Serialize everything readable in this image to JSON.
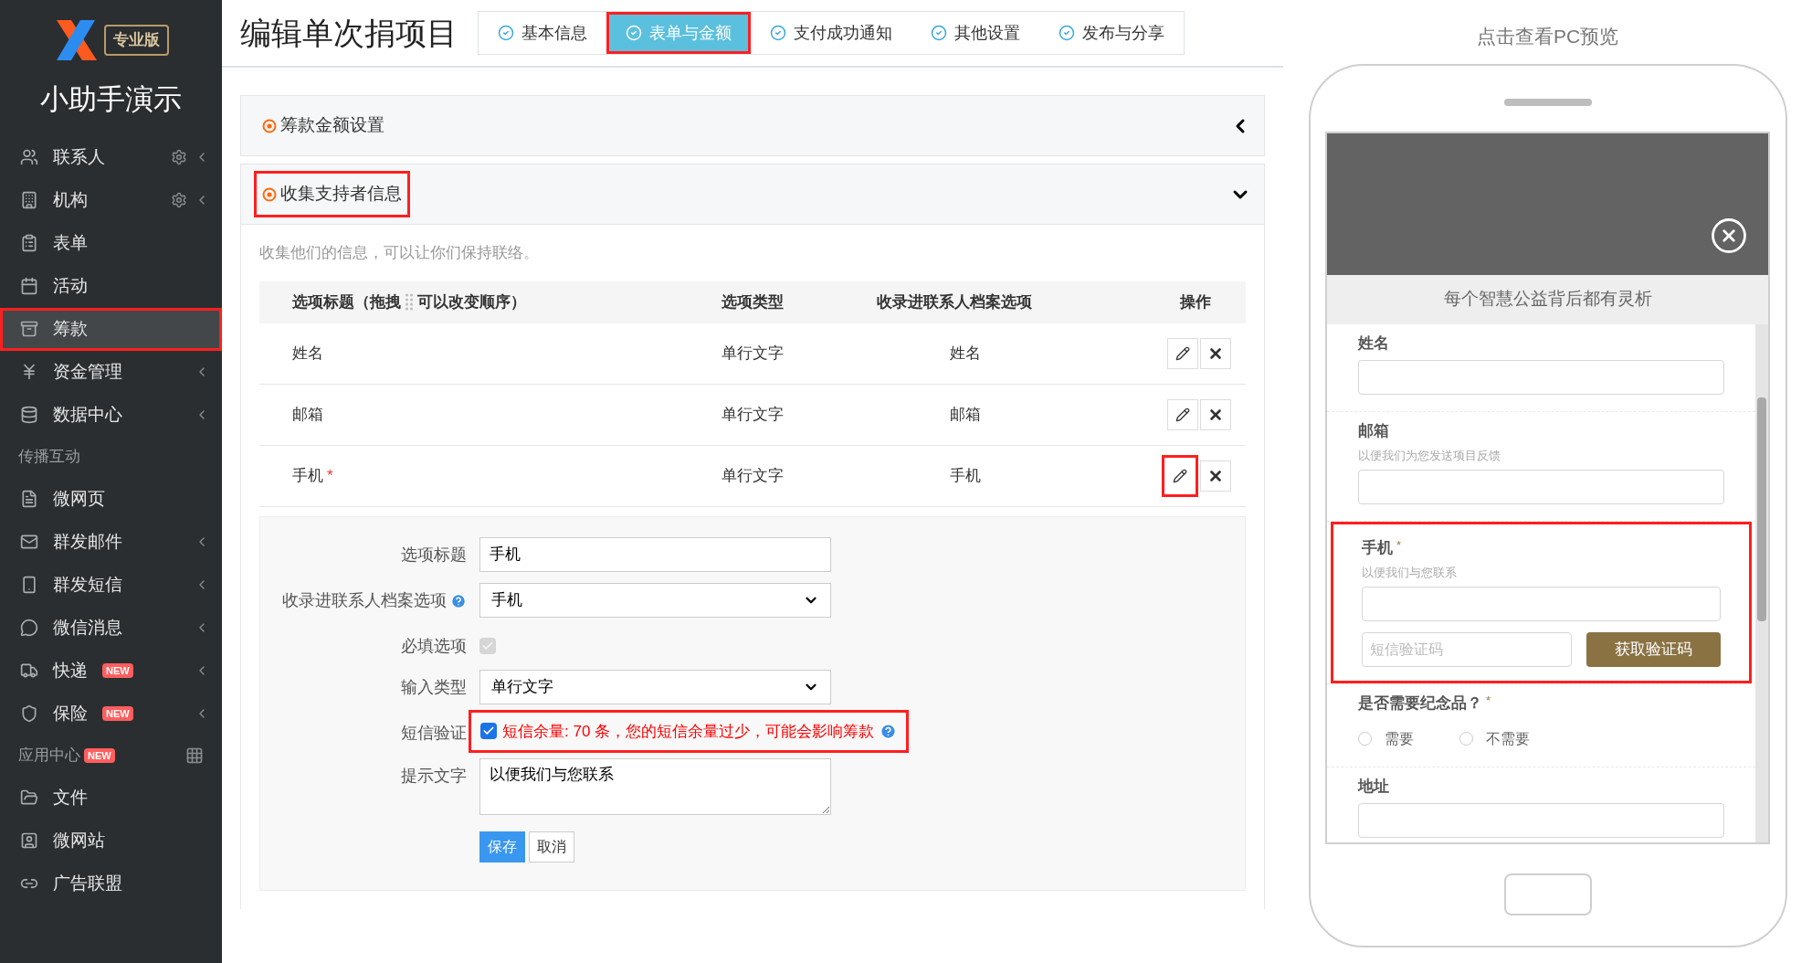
{
  "sidebar": {
    "logo_badge": "专业版",
    "org_name": "小助手演示",
    "items": [
      {
        "kind": "item",
        "label": "联系人",
        "selected": false,
        "settings": true,
        "expandable": true,
        "highlighted": false
      },
      {
        "kind": "item",
        "label": "机构",
        "selected": false,
        "settings": true,
        "expandable": true
      },
      {
        "kind": "item",
        "label": "表单",
        "selected": false,
        "settings": false,
        "expandable": false
      },
      {
        "kind": "item",
        "label": "活动",
        "selected": false,
        "settings": false,
        "expandable": false
      },
      {
        "kind": "item",
        "label": "筹款",
        "selected": true,
        "settings": false,
        "expandable": false,
        "highlighted": true
      },
      {
        "kind": "item",
        "label": "资金管理",
        "selected": false,
        "settings": false,
        "expandable": true
      },
      {
        "kind": "item",
        "label": "数据中心",
        "selected": false,
        "settings": false,
        "expandable": true
      },
      {
        "kind": "section",
        "label": "传播互动"
      },
      {
        "kind": "item",
        "label": "微网页",
        "selected": false,
        "settings": false,
        "expandable": false
      },
      {
        "kind": "item",
        "label": "群发邮件",
        "selected": false,
        "settings": false,
        "expandable": true
      },
      {
        "kind": "item",
        "label": "群发短信",
        "selected": false,
        "settings": false,
        "expandable": true
      },
      {
        "kind": "item",
        "label": "微信消息",
        "selected": false,
        "settings": false,
        "expandable": true
      },
      {
        "kind": "item",
        "label": "快递",
        "selected": false,
        "settings": false,
        "expandable": true,
        "badge": "NEW"
      },
      {
        "kind": "item",
        "label": "保险",
        "selected": false,
        "settings": false,
        "expandable": true,
        "badge": "NEW"
      },
      {
        "kind": "section",
        "label": "应用中心",
        "badge": "NEW",
        "apps": true
      },
      {
        "kind": "item",
        "label": "文件",
        "selected": false,
        "settings": false,
        "expandable": false
      },
      {
        "kind": "item",
        "label": "微网站",
        "selected": false,
        "settings": false,
        "expandable": false
      },
      {
        "kind": "item",
        "label": "广告联盟",
        "selected": false,
        "settings": false,
        "expandable": false
      }
    ]
  },
  "page_title": "编辑单次捐项目",
  "steps": [
    {
      "label": "基本信息",
      "selected": false,
      "highlighted": false
    },
    {
      "label": "表单与金额",
      "selected": true,
      "highlighted": true
    },
    {
      "label": "支付成功通知",
      "selected": false,
      "highlighted": false
    },
    {
      "label": "其他设置",
      "selected": false,
      "highlighted": false
    },
    {
      "label": "发布与分享",
      "selected": false,
      "highlighted": false
    }
  ],
  "panels": [
    {
      "title": "筹款金额设置",
      "expanded": false,
      "highlighted": false
    },
    {
      "title": "收集支持者信息",
      "expanded": true,
      "highlighted": true
    }
  ],
  "description": "收集他们的信息，可以让你们保持联络。",
  "table": {
    "columns": [
      "选项标题（拖拽",
      "可以改变顺序）",
      "选项类型",
      "收录进联系人档案选项",
      "操作"
    ],
    "rows": [
      {
        "title": "姓名",
        "type": "单行文字",
        "profile_field": "姓名",
        "edit_highlighted": false
      },
      {
        "title": "邮箱",
        "type": "单行文字",
        "profile_field": "邮箱",
        "edit_highlighted": false
      },
      {
        "title": "手机",
        "required_mark": "*",
        "type": "单行文字",
        "profile_field": "手机",
        "edit_highlighted": true
      }
    ]
  },
  "edit_form": {
    "fields": [
      {
        "kind": "text",
        "label": "选项标题",
        "value": "手机"
      },
      {
        "kind": "select",
        "label": "收录进联系人档案选项",
        "value": "手机",
        "help": true
      },
      {
        "kind": "checkbox",
        "label": "必填选项",
        "checked": true,
        "disabled": true
      },
      {
        "kind": "select",
        "label": "输入类型",
        "value": "单行文字"
      },
      {
        "kind": "sms",
        "label": "短信验证",
        "checked": true,
        "note": "短信余量: 70 条，您的短信余量过少，可能会影响筹款",
        "highlighted": true
      },
      {
        "kind": "textarea",
        "label": "提示文字",
        "value": "以便我们与您联系"
      }
    ],
    "buttons": [
      {
        "label": "保存",
        "primary": true
      },
      {
        "label": "取消",
        "primary": false
      }
    ]
  },
  "preview": {
    "link": "点击查看PC预览",
    "subtitle": "每个智慧公益背后都有灵析",
    "fields": [
      {
        "kind": "text",
        "label": "姓名",
        "highlighted": false
      },
      {
        "kind": "text",
        "label": "邮箱",
        "hint": "以便我们为您发送项目反馈",
        "highlighted": false
      },
      {
        "kind": "sms",
        "label": "手机",
        "hint": "以便我们与您联系",
        "required_mark": "*",
        "code_placeholder": "短信验证码",
        "button": "获取验证码",
        "highlighted": true
      },
      {
        "kind": "radio",
        "label": "是否需要纪念品？",
        "required_mark": "*",
        "highlighted": false,
        "options": [
          {
            "label": "需要",
            "selected": false
          },
          {
            "label": "不需要",
            "selected": false
          }
        ]
      },
      {
        "kind": "text",
        "label": "地址",
        "highlighted": false
      }
    ]
  }
}
